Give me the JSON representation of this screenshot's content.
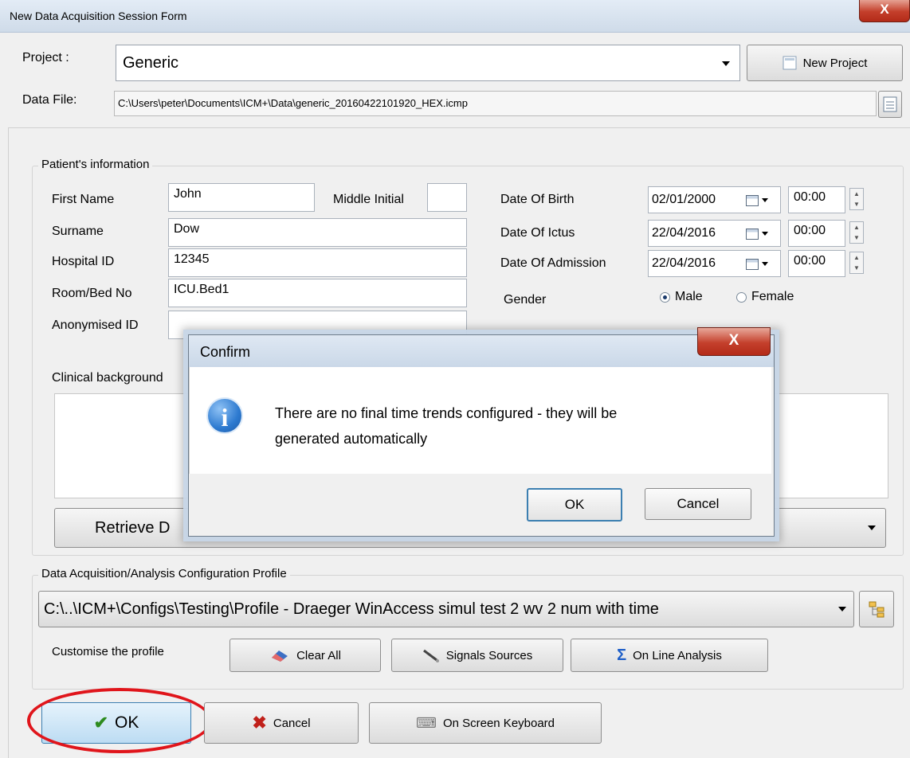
{
  "window": {
    "title": "New Data Acquisition Session Form",
    "close": "X"
  },
  "project": {
    "label": "Project :",
    "value": "Generic",
    "new_button": "New Project"
  },
  "datafile": {
    "label": "Data File:",
    "path": "C:\\Users\\peter\\Documents\\ICM+\\Data\\generic_20160422101920_HEX.icmp"
  },
  "patient": {
    "group_title": "Patient's information",
    "first_name_label": "First Name",
    "first_name": "John",
    "middle_initial_label": "Middle Initial",
    "middle_initial": "",
    "surname_label": "Surname",
    "surname": "Dow",
    "hospital_id_label": "Hospital ID",
    "hospital_id": "12345",
    "room_label": "Room/Bed No",
    "room": "ICU.Bed1",
    "anon_label": "Anonymised ID",
    "anon": "",
    "dob_label": "Date Of Birth",
    "dob": "02/01/2000",
    "dob_time": "00:00",
    "ictus_label": "Date Of Ictus",
    "ictus": "22/04/2016",
    "ictus_time": "00:00",
    "admission_label": "Date Of Admission",
    "admission": "22/04/2016",
    "admission_time": "00:00",
    "gender_label": "Gender",
    "male": "Male",
    "female": "Female",
    "gender_selected": "Male",
    "clinical_label": "Clinical background",
    "retrieve_label": "Retrieve D"
  },
  "profile": {
    "group_title": "Data Acquisition/Analysis Configuration Profile",
    "path": "C:\\..\\ICM+\\Configs\\Testing\\Profile - Draeger WinAccess simul test 2 wv 2 num with time",
    "customise_label": "Customise the profile",
    "clear_all": "Clear All",
    "signals_sources": "Signals Sources",
    "online_analysis": "On Line Analysis"
  },
  "footer": {
    "ok": "OK",
    "cancel": "Cancel",
    "keyboard": "On Screen Keyboard"
  },
  "dialog": {
    "title": "Confirm",
    "message_line1": "There are no final time trends configured - they will be",
    "message_line2": "generated automatically",
    "ok": "OK",
    "cancel": "Cancel",
    "close": "X"
  },
  "colors": {
    "highlight_ring": "#e0151b",
    "ok_check": "#2e8b1e",
    "cancel_x": "#c0201a",
    "sigma": "#1f5fc8"
  }
}
